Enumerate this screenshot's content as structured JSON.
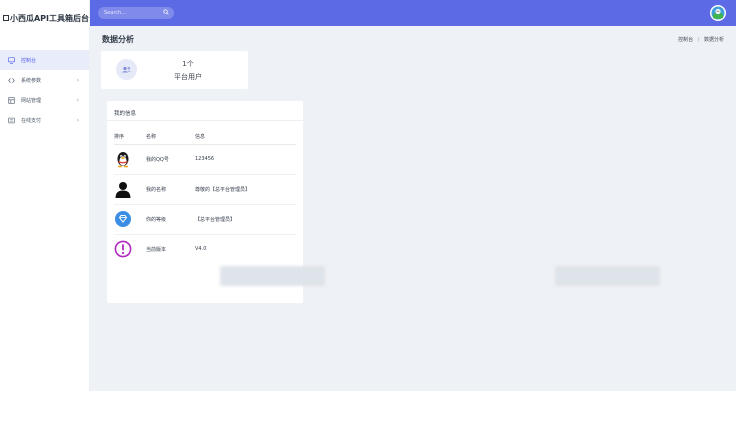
{
  "brand": {
    "title": "小西瓜API工具箱后台"
  },
  "search": {
    "placeholder": "Search..."
  },
  "sidebar": {
    "items": [
      {
        "label": "控制台",
        "icon": "monitor-icon",
        "active": true,
        "has_arrow": false
      },
      {
        "label": "系统参数",
        "icon": "code-icon",
        "active": false,
        "has_arrow": true
      },
      {
        "label": "网站管理",
        "icon": "grid-icon",
        "active": false,
        "has_arrow": true
      },
      {
        "label": "在线支付",
        "icon": "card-icon",
        "active": false,
        "has_arrow": true
      }
    ]
  },
  "main": {
    "page_title": "数据分析",
    "breadcrumb": [
      "控制台",
      "数据分析"
    ]
  },
  "stat_card": {
    "value": "1个",
    "label": "平台用户",
    "icon": "users-icon"
  },
  "info_card": {
    "title": "我的信息",
    "columns": [
      "排序",
      "名称",
      "信息"
    ],
    "rows": [
      {
        "icon": "qq-penguin-icon",
        "name": "我的QQ号",
        "value": "123456"
      },
      {
        "icon": "user-silhouette-icon",
        "name": "我的名称",
        "value": "尊敬的【总平台管理员】"
      },
      {
        "icon": "diamond-icon",
        "name": "你的等级",
        "value": "【总平台管理员】"
      },
      {
        "icon": "exclamation-icon",
        "name": "当前版本",
        "value": "V4.0"
      }
    ]
  },
  "colors": {
    "topbar": "#5d6ae6",
    "active_nav_bg": "#e9ecfb",
    "active_nav_text": "#5664e8",
    "link": "#4a86e8",
    "content_bg": "#eef1f5"
  }
}
